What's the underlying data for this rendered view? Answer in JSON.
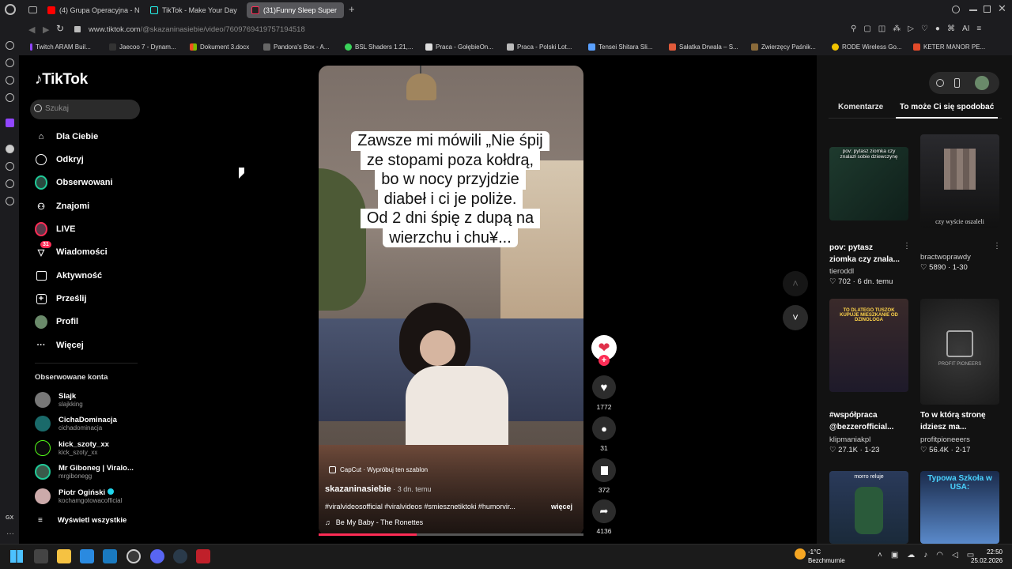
{
  "browser": {
    "tabs": [
      {
        "label": "(4) Grupa Operacyjna - Ni",
        "icon": "youtube-icon"
      },
      {
        "label": "TikTok - Make Your Day",
        "icon": "tiktok-icon"
      },
      {
        "label": "(31)Funny Sleep Super",
        "icon": "tiktok-icon",
        "active": true
      }
    ],
    "url_host": "www.tiktok.com",
    "url_path": "/@skazaninasiebie/video/7609769419757194518",
    "ai_label": "AI",
    "bookmarks": [
      "Twitch ARAM Buil...",
      "Jaecoo 7 - Dynam...",
      "Dokument 3.docx",
      "Pandora's Box - A...",
      "BSL Shaders 1.21,...",
      "Praca - GołębieOn...",
      "Praca - Polski Lot...",
      "Tensei Shitara Sli...",
      "Sałatka Drwala – S...",
      "Zwierzęcy Paśnik...",
      "RODE Wireless Go...",
      "KETER MANOR PE..."
    ]
  },
  "tiktok": {
    "logo": "TikTok",
    "search_placeholder": "Szukaj",
    "nav": [
      {
        "label": "Dla Ciebie",
        "icon": "home-icon"
      },
      {
        "label": "Odkryj",
        "icon": "compass-icon"
      },
      {
        "label": "Obserwowani",
        "icon": "following-avatar-icon"
      },
      {
        "label": "Znajomi",
        "icon": "friends-icon"
      },
      {
        "label": "LIVE",
        "icon": "live-icon"
      },
      {
        "label": "Wiadomości",
        "icon": "messages-icon",
        "badge": "31"
      },
      {
        "label": "Aktywność",
        "icon": "activity-icon"
      },
      {
        "label": "Prześlij",
        "icon": "upload-icon"
      },
      {
        "label": "Profil",
        "icon": "profile-avatar-icon"
      },
      {
        "label": "Więcej",
        "icon": "more-icon"
      }
    ],
    "followed_title": "Obserwowane konta",
    "followed": [
      {
        "name": "Slajk",
        "handle": "slajkking"
      },
      {
        "name": "CichaDominacja",
        "handle": "cichadominacja"
      },
      {
        "name": "kick_szoty_xx",
        "handle": "kick_szoty_xx"
      },
      {
        "name": "Mr Giboneg | Viralo...",
        "handle": "mrgibonegg"
      },
      {
        "name": "Piotr Ogiński",
        "handle": "kochamgotowacofficial"
      }
    ],
    "show_all": "Wyświetl wszystkie"
  },
  "video": {
    "caption_lines": [
      "Zawsze mi mówili „Nie śpij",
      "ze stopami poza kołdrą,",
      "bo w nocy przyjdzie",
      "diabeł i ci je poliże.",
      "Od 2 dni śpię z dupą na",
      "wierzchu i chu¥..."
    ],
    "template_label": "CapCut · Wypróbuj ten szablon",
    "author": "skazaninasiebie",
    "time": "· 3 dn. temu",
    "hashtags": "#viralvideosofficial #viralvideos #smiesznetiktoki #humorvir...",
    "more": "więcej",
    "music": "Be My Baby - The Ronettes",
    "progress": 0.37
  },
  "actions": {
    "likes": "1772",
    "comments": "31",
    "saves": "372",
    "shares": "4136"
  },
  "right_panel": {
    "tab_comments": "Komentarze",
    "tab_suggested": "To może Ci się spodobać",
    "cards": [
      {
        "thumb_text": "pov: pytasz ziomka czy znalazł sobie dziewczynę",
        "title_lines": [
          "pov: pytasz",
          "ziomka czy znala..."
        ],
        "user": "tieroddl",
        "likes": "702",
        "age": "6 dn. temu"
      },
      {
        "thumb_text": "czy wyście oszaleli",
        "title_lines": [],
        "user": "bractwoprawdy",
        "likes": "5890",
        "age": "1-30"
      },
      {
        "thumb_text": "TO DLATEGO TUSZOK KUPUJE MIESZKANIE OD DZINOLOGA",
        "title_lines": [
          "#współpraca",
          "@bezzerofficial..."
        ],
        "user": "klipmaniakpl",
        "likes": "27.1K",
        "age": "1-23"
      },
      {
        "thumb_text": "PROFIT PIONEERS",
        "title_lines": [
          "To w którą stronę",
          "idziesz ma..."
        ],
        "user": "profitpioneeers",
        "likes": "56.4K",
        "age": "2-17"
      },
      {
        "thumb_text": "morro reluje",
        "title_lines": [],
        "user": "",
        "likes": "",
        "age": ""
      },
      {
        "thumb_text": "Typowa Szkoła w USA:",
        "title_lines": [],
        "user": "",
        "likes": "",
        "age": ""
      }
    ]
  },
  "taskbar": {
    "weather_temp": "-1°C",
    "weather_desc": "Bezchmurnie",
    "time": "22:50",
    "date": "25.02.2026",
    "gx": "GX"
  }
}
